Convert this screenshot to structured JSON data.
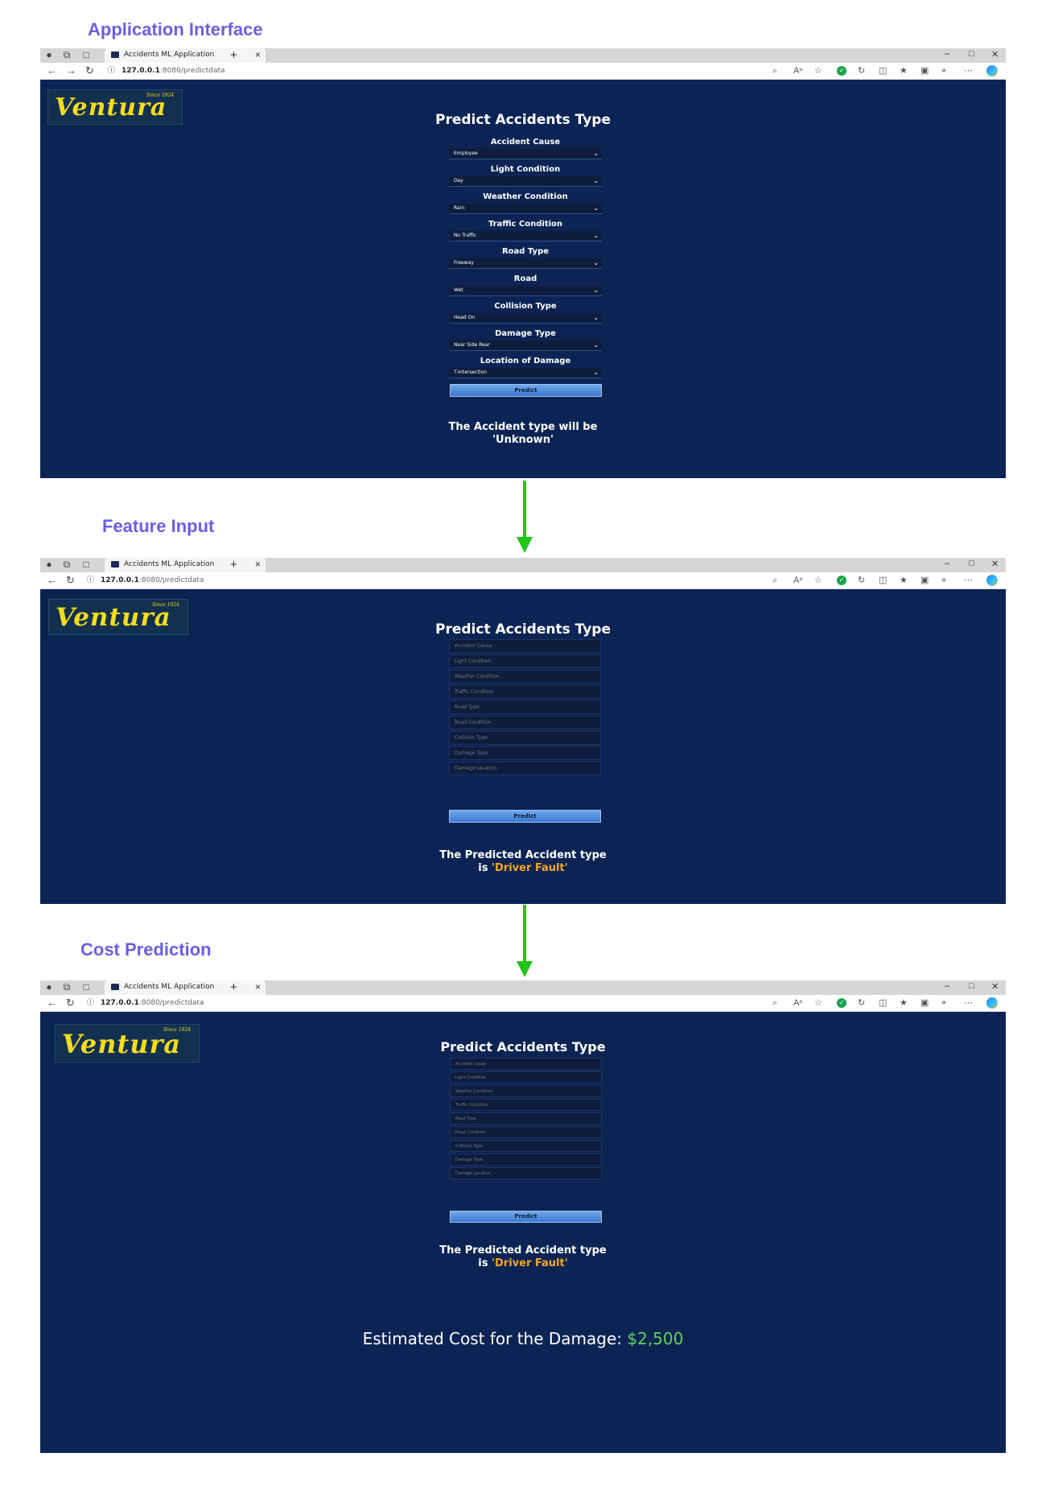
{
  "sections": {
    "s1": "Application Interface",
    "s2": "Feature Input",
    "s3": "Cost Prediction"
  },
  "browser": {
    "tab_title": "Accidents ML Application",
    "url_host": "127.0.0.1",
    "url_rest": ":8080/predictdata"
  },
  "logo": {
    "brand": "Ventura",
    "since": "Since 1924"
  },
  "form": {
    "title": "Predict Accidents Type",
    "predict_label": "Predict"
  },
  "panel1": {
    "fields": [
      {
        "label": "Accident Cause",
        "value": "Employee"
      },
      {
        "label": "Light Condition",
        "value": "Day"
      },
      {
        "label": "Weather Condition",
        "value": "Rain"
      },
      {
        "label": "Traffic Condition",
        "value": "No Traffic"
      },
      {
        "label": "Road Type",
        "value": "Freeway"
      },
      {
        "label": "Road",
        "value": "Wet"
      },
      {
        "label": "Collision Type",
        "value": "Head On"
      },
      {
        "label": "Damage Type",
        "value": "Near Side Rear"
      },
      {
        "label": "Location of Damage",
        "value": "T-Intersection"
      }
    ],
    "result_line1": "The Accident type will be",
    "result_line2": "'Unknown'"
  },
  "inputs": {
    "placeholders": [
      "Accident Cause",
      "Light Condition",
      "Weather Condition",
      "Traffic Condition",
      "Road Type",
      "Road Condition",
      "Collision Type",
      "Damage Type",
      "Damage Location"
    ]
  },
  "prediction": {
    "line1": "The Predicted Accident type",
    "prefix": "is ",
    "value": "'Driver Fault'"
  },
  "cost": {
    "label": "Estimated Cost for the Damage: ",
    "amount": "$2,500"
  },
  "colors": {
    "page_bg": "#0c2454",
    "section_title": "#6a5fe0",
    "logo_yellow": "#f6dc1c",
    "result_orange": "#f5a623",
    "cost_green": "#5fd35f",
    "arrow_green": "#22c41a"
  },
  "icons": [
    "profile-icon",
    "workspaces-icon",
    "tab-actions-icon",
    "back-icon",
    "forward-icon",
    "refresh-icon",
    "info-icon",
    "zoom-icon",
    "read-aloud-icon",
    "favorite-icon",
    "extension-icon",
    "split-screen-icon",
    "favorites-icon",
    "collections-icon",
    "more-icon",
    "copilot-icon"
  ]
}
